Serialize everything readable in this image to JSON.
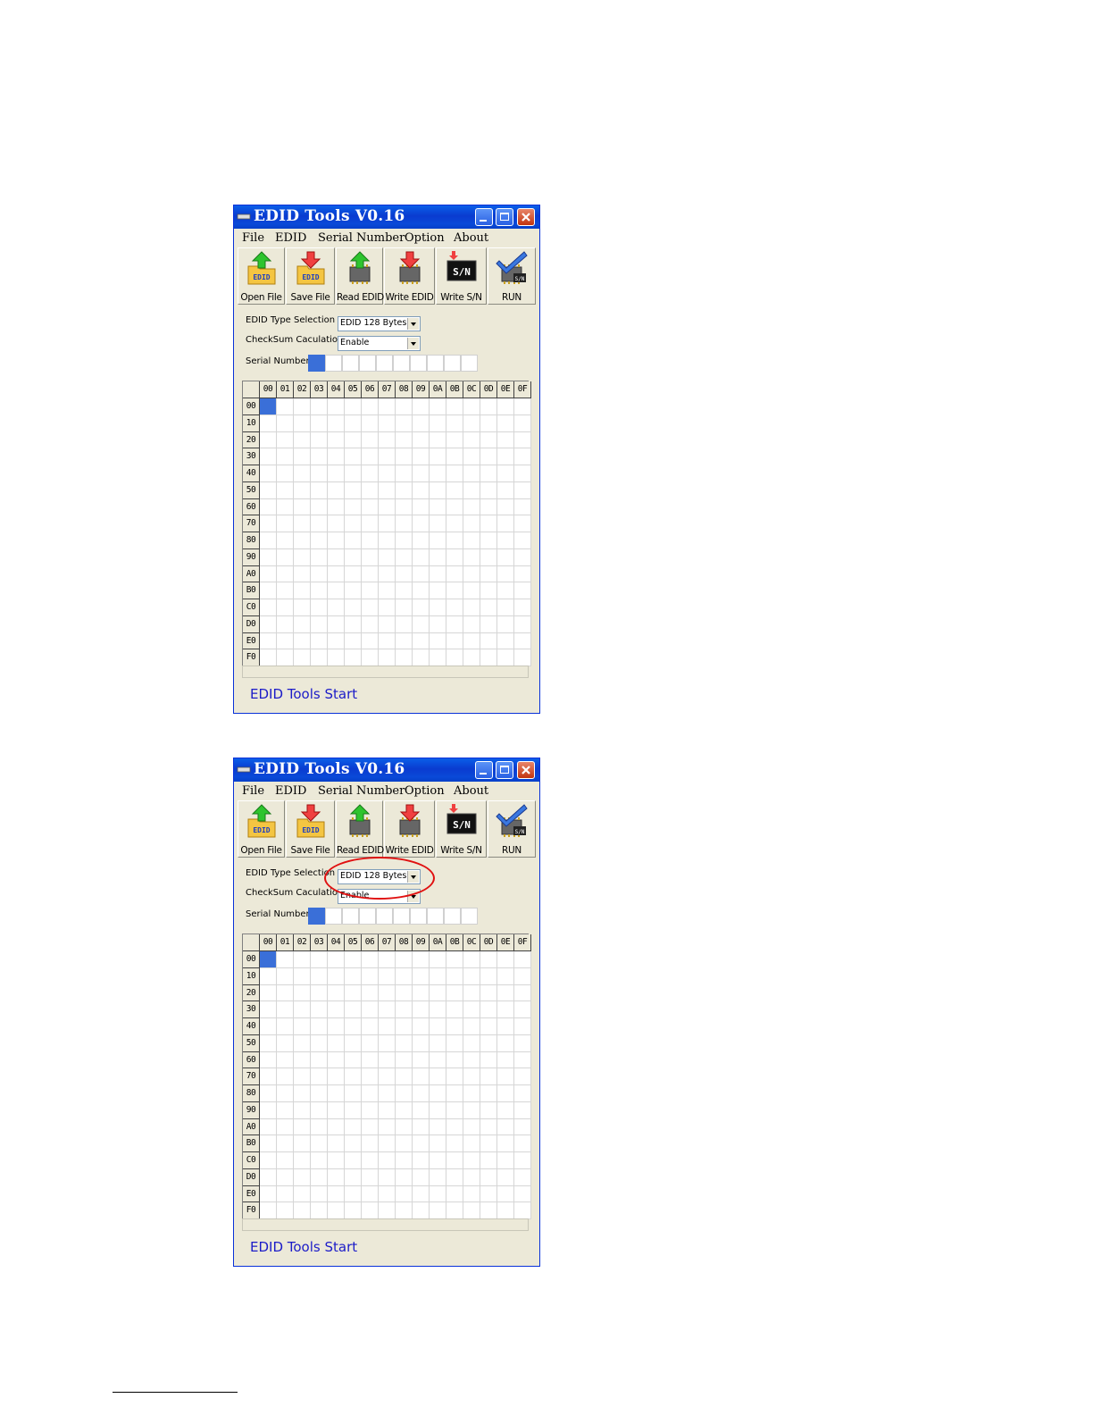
{
  "windows": [
    {
      "title": "EDID Tools V0.16",
      "menu": [
        "File",
        "EDID",
        "Serial Number",
        "Option",
        "About"
      ],
      "toolbar": [
        "Open File",
        "Save File",
        "Read EDID",
        "Write EDID",
        "Write S/N",
        "RUN"
      ],
      "edid_type_label": "EDID Type Selection",
      "edid_type_value": "EDID 128 Bytes",
      "checksum_label": "CheckSum Caculation",
      "checksum_value": "Enable",
      "serial_label": "Serial Number =",
      "status": "EDID Tools Start"
    },
    {
      "title": "EDID Tools V0.16",
      "menu": [
        "File",
        "EDID",
        "Serial Number",
        "Option",
        "About"
      ],
      "toolbar": [
        "Open File",
        "Save File",
        "Read EDID",
        "Write EDID",
        "Write S/N",
        "RUN"
      ],
      "edid_type_label": "EDID Type Selection",
      "edid_type_value": "EDID 128 Bytes",
      "checksum_label": "CheckSum Caculation",
      "checksum_value": "Enable",
      "serial_label": "Serial Number =",
      "status": "EDID Tools Start"
    }
  ],
  "grid": {
    "columns": [
      "00",
      "01",
      "02",
      "03",
      "04",
      "05",
      "06",
      "07",
      "08",
      "09",
      "0A",
      "0B",
      "0C",
      "0D",
      "0E",
      "0F"
    ],
    "rows": [
      "00",
      "10",
      "20",
      "30",
      "40",
      "50",
      "60",
      "70",
      "80",
      "90",
      "A0",
      "B0",
      "C0",
      "D0",
      "E0",
      "F0"
    ]
  },
  "icons": [
    "edid-folder-open-icon",
    "edid-folder-save-icon",
    "chip-read-icon",
    "chip-write-icon",
    "sn-write-icon",
    "run-check-icon"
  ],
  "colors": {
    "selection": "#3a6fd8",
    "status_text": "#1c1cc8",
    "highlight_circle": "#e01010"
  }
}
